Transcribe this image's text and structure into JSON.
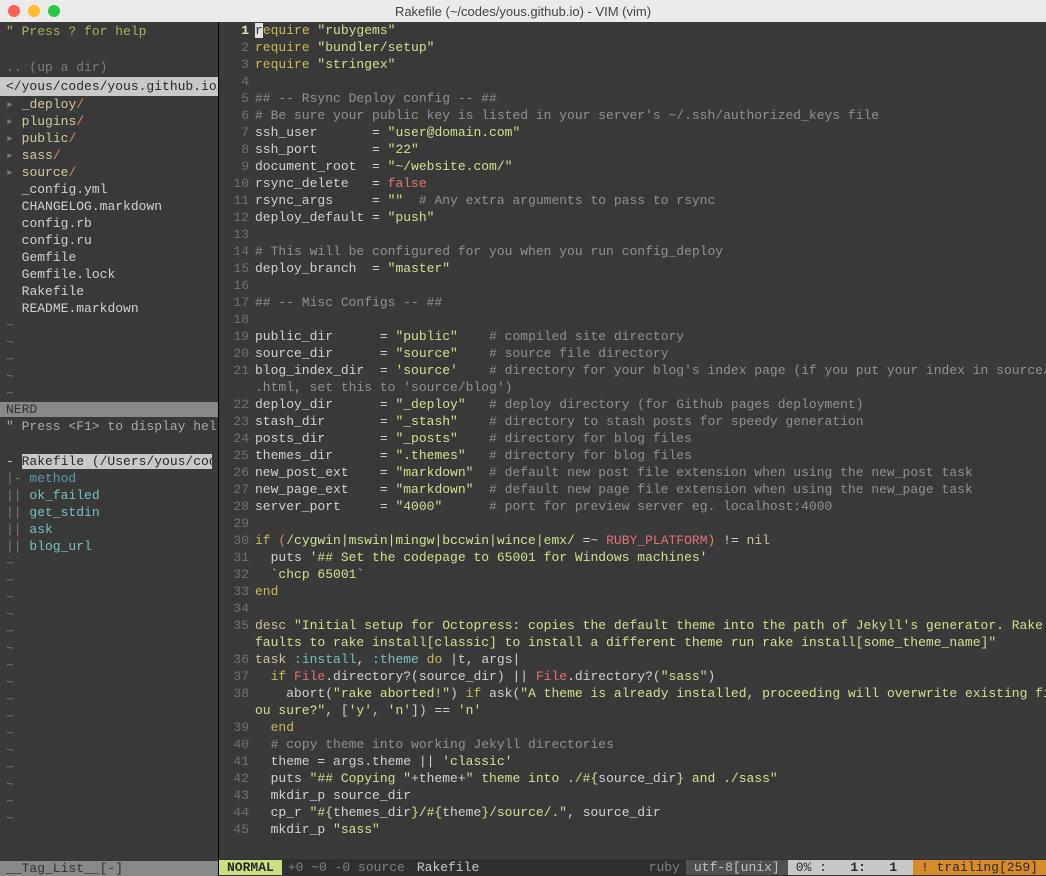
{
  "window": {
    "title": "Rakefile (~/codes/yous.github.io) - VIM (vim)"
  },
  "nerdtree": {
    "help": "\" Press ? for help",
    "updir": ".. (up a dir)",
    "path": "</yous/codes/yous.github.io/",
    "dirs": [
      "_deploy",
      "plugins",
      "public",
      "sass",
      "source"
    ],
    "files": [
      "_config.yml",
      "CHANGELOG.markdown",
      "config.rb",
      "config.ru",
      "Gemfile",
      "Gemfile.lock",
      "Rakefile",
      "README.markdown"
    ],
    "panel_label": "NERD"
  },
  "taglist": {
    "help": "\" Press <F1> to display hel",
    "title": "Rakefile (/Users/yous/codes",
    "group": "method",
    "items": [
      "ok_failed",
      "get_stdin",
      "ask",
      "blog_url"
    ],
    "status": "__Tag_List__[-]"
  },
  "code": {
    "lines": [
      {
        "n": 1,
        "cur": true,
        "segs": [
          [
            "r",
            "cursor"
          ],
          [
            "equire ",
            "tk-kw"
          ],
          [
            "\"rubygems\"",
            "tk-str"
          ]
        ]
      },
      {
        "n": 2,
        "segs": [
          [
            "require ",
            "tk-kw"
          ],
          [
            "\"bundler/setup\"",
            "tk-str"
          ]
        ]
      },
      {
        "n": 3,
        "segs": [
          [
            "require ",
            "tk-kw"
          ],
          [
            "\"stringex\"",
            "tk-str"
          ]
        ]
      },
      {
        "n": 4,
        "segs": []
      },
      {
        "n": 5,
        "segs": [
          [
            "## -- Rsync Deploy config -- ##",
            "tk-comment"
          ]
        ]
      },
      {
        "n": 6,
        "segs": [
          [
            "# Be sure your public key is listed in your server's ~/.ssh/authorized_keys file",
            "tk-comment"
          ]
        ]
      },
      {
        "n": 7,
        "segs": [
          [
            "ssh_user",
            ""
          ],
          [
            "       = ",
            ""
          ],
          [
            "\"user@domain.com\"",
            "tk-str"
          ]
        ]
      },
      {
        "n": 8,
        "segs": [
          [
            "ssh_port",
            ""
          ],
          [
            "       = ",
            ""
          ],
          [
            "\"22\"",
            "tk-str"
          ]
        ]
      },
      {
        "n": 9,
        "segs": [
          [
            "document_root",
            ""
          ],
          [
            "  = ",
            ""
          ],
          [
            "\"~/website.com/\"",
            "tk-str"
          ]
        ]
      },
      {
        "n": 10,
        "segs": [
          [
            "rsync_delete",
            ""
          ],
          [
            "   = ",
            ""
          ],
          [
            "false",
            "tk-false"
          ]
        ]
      },
      {
        "n": 11,
        "segs": [
          [
            "rsync_args",
            ""
          ],
          [
            "     = ",
            ""
          ],
          [
            "\"\"",
            "tk-str"
          ],
          [
            "  # Any extra arguments to pass to rsync",
            "tk-comment"
          ]
        ]
      },
      {
        "n": 12,
        "segs": [
          [
            "deploy_default",
            ""
          ],
          [
            " = ",
            ""
          ],
          [
            "\"push\"",
            "tk-str"
          ]
        ]
      },
      {
        "n": 13,
        "segs": []
      },
      {
        "n": 14,
        "segs": [
          [
            "# This will be configured for you when you run config_deploy",
            "tk-comment"
          ]
        ]
      },
      {
        "n": 15,
        "segs": [
          [
            "deploy_branch",
            ""
          ],
          [
            "  = ",
            ""
          ],
          [
            "\"master\"",
            "tk-str"
          ]
        ]
      },
      {
        "n": 16,
        "segs": []
      },
      {
        "n": 17,
        "segs": [
          [
            "## -- Misc Configs -- ##",
            "tk-comment"
          ]
        ]
      },
      {
        "n": 18,
        "segs": []
      },
      {
        "n": 19,
        "segs": [
          [
            "public_dir",
            ""
          ],
          [
            "      = ",
            ""
          ],
          [
            "\"public\"",
            "tk-str"
          ],
          [
            "    # compiled site directory",
            "tk-comment"
          ]
        ]
      },
      {
        "n": 20,
        "segs": [
          [
            "source_dir",
            ""
          ],
          [
            "      = ",
            ""
          ],
          [
            "\"source\"",
            "tk-str"
          ],
          [
            "    # source file directory",
            "tk-comment"
          ]
        ]
      },
      {
        "n": 21,
        "segs": [
          [
            "blog_index_dir",
            ""
          ],
          [
            "  = ",
            ""
          ],
          [
            "'source'",
            "tk-str"
          ],
          [
            "    # directory for your blog's index page (if you put your index in source/blog/index",
            "tk-comment"
          ]
        ]
      },
      {
        "n": "",
        "segs": [
          [
            ".html, set this to 'source/blog')",
            "tk-comment"
          ]
        ]
      },
      {
        "n": 22,
        "segs": [
          [
            "deploy_dir",
            ""
          ],
          [
            "      = ",
            ""
          ],
          [
            "\"_deploy\"",
            "tk-str"
          ],
          [
            "   # deploy directory (for Github pages deployment)",
            "tk-comment"
          ]
        ]
      },
      {
        "n": 23,
        "segs": [
          [
            "stash_dir",
            ""
          ],
          [
            "       = ",
            ""
          ],
          [
            "\"_stash\"",
            "tk-str"
          ],
          [
            "    # directory to stash posts for speedy generation",
            "tk-comment"
          ]
        ]
      },
      {
        "n": 24,
        "segs": [
          [
            "posts_dir",
            ""
          ],
          [
            "       = ",
            ""
          ],
          [
            "\"_posts\"",
            "tk-str"
          ],
          [
            "    # directory for blog files",
            "tk-comment"
          ]
        ]
      },
      {
        "n": 25,
        "segs": [
          [
            "themes_dir",
            ""
          ],
          [
            "      = ",
            ""
          ],
          [
            "\".themes\"",
            "tk-str"
          ],
          [
            "   # directory for blog files",
            "tk-comment"
          ]
        ]
      },
      {
        "n": 26,
        "segs": [
          [
            "new_post_ext",
            ""
          ],
          [
            "    = ",
            ""
          ],
          [
            "\"markdown\"",
            "tk-str"
          ],
          [
            "  # default new post file extension when using the new_post task",
            "tk-comment"
          ]
        ]
      },
      {
        "n": 27,
        "segs": [
          [
            "new_page_ext",
            ""
          ],
          [
            "    = ",
            ""
          ],
          [
            "\"markdown\"",
            "tk-str"
          ],
          [
            "  # default new page file extension when using the new_page task",
            "tk-comment"
          ]
        ]
      },
      {
        "n": 28,
        "segs": [
          [
            "server_port",
            ""
          ],
          [
            "     = ",
            ""
          ],
          [
            "\"4000\"",
            "tk-str"
          ],
          [
            "      # port for preview server eg. localhost:4000",
            "tk-comment"
          ]
        ]
      },
      {
        "n": 29,
        "segs": []
      },
      {
        "n": 30,
        "segs": [
          [
            "if ",
            "tk-kw"
          ],
          [
            "(",
            "tk-paren"
          ],
          [
            "/cygwin|mswin|mingw|bccwin|wince|emx/",
            "tk-regex"
          ],
          [
            " =~ ",
            ""
          ],
          [
            "RUBY_PLATFORM",
            "tk-const"
          ],
          [
            ")",
            "tk-paren"
          ],
          [
            " != ",
            ""
          ],
          [
            "nil",
            "tk-ident"
          ]
        ]
      },
      {
        "n": 31,
        "segs": [
          [
            "  puts ",
            ""
          ],
          [
            "'## Set the codepage to 65001 for Windows machines'",
            "tk-str"
          ]
        ]
      },
      {
        "n": 32,
        "segs": [
          [
            "  ",
            ""
          ],
          [
            "`chcp 65001`",
            "tk-str"
          ]
        ]
      },
      {
        "n": 33,
        "segs": [
          [
            "end",
            "tk-kw"
          ]
        ]
      },
      {
        "n": 34,
        "segs": []
      },
      {
        "n": 35,
        "segs": [
          [
            "desc ",
            "tk-ident"
          ],
          [
            "\"Initial setup for Octopress: copies the default theme into the path of Jekyll's generator. Rake install de",
            "tk-str"
          ]
        ]
      },
      {
        "n": "",
        "segs": [
          [
            "faults to rake install[classic] to install a different theme run rake install[some_theme_name]\"",
            "tk-str"
          ]
        ]
      },
      {
        "n": 36,
        "segs": [
          [
            "task ",
            "tk-ident"
          ],
          [
            ":install",
            "tk-sym"
          ],
          [
            ", ",
            ""
          ],
          [
            ":theme",
            "tk-sym"
          ],
          [
            " do ",
            "tk-kw"
          ],
          [
            "|",
            ""
          ],
          [
            "t",
            ""
          ],
          [
            ", ",
            ""
          ],
          [
            "args",
            ""
          ],
          [
            "|",
            ""
          ]
        ]
      },
      {
        "n": 37,
        "segs": [
          [
            "  ",
            ""
          ],
          [
            "if ",
            "tk-kw"
          ],
          [
            "File",
            "tk-const"
          ],
          [
            ".directory?(source_dir) || ",
            ""
          ],
          [
            "File",
            "tk-const"
          ],
          [
            ".directory?(",
            ""
          ],
          [
            "\"sass\"",
            "tk-str"
          ],
          [
            ")",
            ""
          ]
        ]
      },
      {
        "n": 38,
        "segs": [
          [
            "    abort(",
            ""
          ],
          [
            "\"rake aborted!\"",
            "tk-str"
          ],
          [
            ") ",
            ""
          ],
          [
            "if ",
            "tk-kw"
          ],
          [
            "ask(",
            ""
          ],
          [
            "\"A theme is already installed, proceeding will overwrite existing files. Are y",
            "tk-str"
          ]
        ]
      },
      {
        "n": "",
        "segs": [
          [
            "ou sure?\"",
            "tk-str"
          ],
          [
            ", [",
            ""
          ],
          [
            "'y'",
            "tk-str"
          ],
          [
            ", ",
            ""
          ],
          [
            "'n'",
            "tk-str"
          ],
          [
            "]) == ",
            ""
          ],
          [
            "'n'",
            "tk-str"
          ]
        ]
      },
      {
        "n": 39,
        "segs": [
          [
            "  ",
            ""
          ],
          [
            "end",
            "tk-kw"
          ]
        ]
      },
      {
        "n": 40,
        "segs": [
          [
            "  ",
            ""
          ],
          [
            "# copy theme into working Jekyll directories",
            "tk-comment"
          ]
        ]
      },
      {
        "n": 41,
        "segs": [
          [
            "  theme = args.theme || ",
            ""
          ],
          [
            "'classic'",
            "tk-str"
          ]
        ]
      },
      {
        "n": 42,
        "segs": [
          [
            "  puts ",
            ""
          ],
          [
            "\"## Copying \"",
            "tk-str"
          ],
          [
            "+theme+",
            ""
          ],
          [
            "\" theme into ./#{",
            "tk-str"
          ],
          [
            "source_dir",
            ""
          ],
          [
            "} and ./sass\"",
            "tk-str"
          ]
        ]
      },
      {
        "n": 43,
        "segs": [
          [
            "  mkdir_p source_dir",
            ""
          ]
        ]
      },
      {
        "n": 44,
        "segs": [
          [
            "  cp_r ",
            ""
          ],
          [
            "\"#{",
            "tk-str"
          ],
          [
            "themes_dir",
            ""
          ],
          [
            "}/#{",
            "tk-str"
          ],
          [
            "theme",
            ""
          ],
          [
            "}/source/.\"",
            "tk-str"
          ],
          [
            ", source_dir",
            ""
          ]
        ]
      },
      {
        "n": 45,
        "segs": [
          [
            "  mkdir_p ",
            ""
          ],
          [
            "\"sass\"",
            "tk-str"
          ]
        ]
      }
    ]
  },
  "statusbar": {
    "mode": "NORMAL",
    "modifiers": "+0 ~0 -0 source",
    "filename": "Rakefile",
    "filetype": "ruby",
    "encoding": "utf-8[unix]",
    "percent": "0% :",
    "line": "1:",
    "col": "1",
    "trailing": "! trailing[259]"
  }
}
